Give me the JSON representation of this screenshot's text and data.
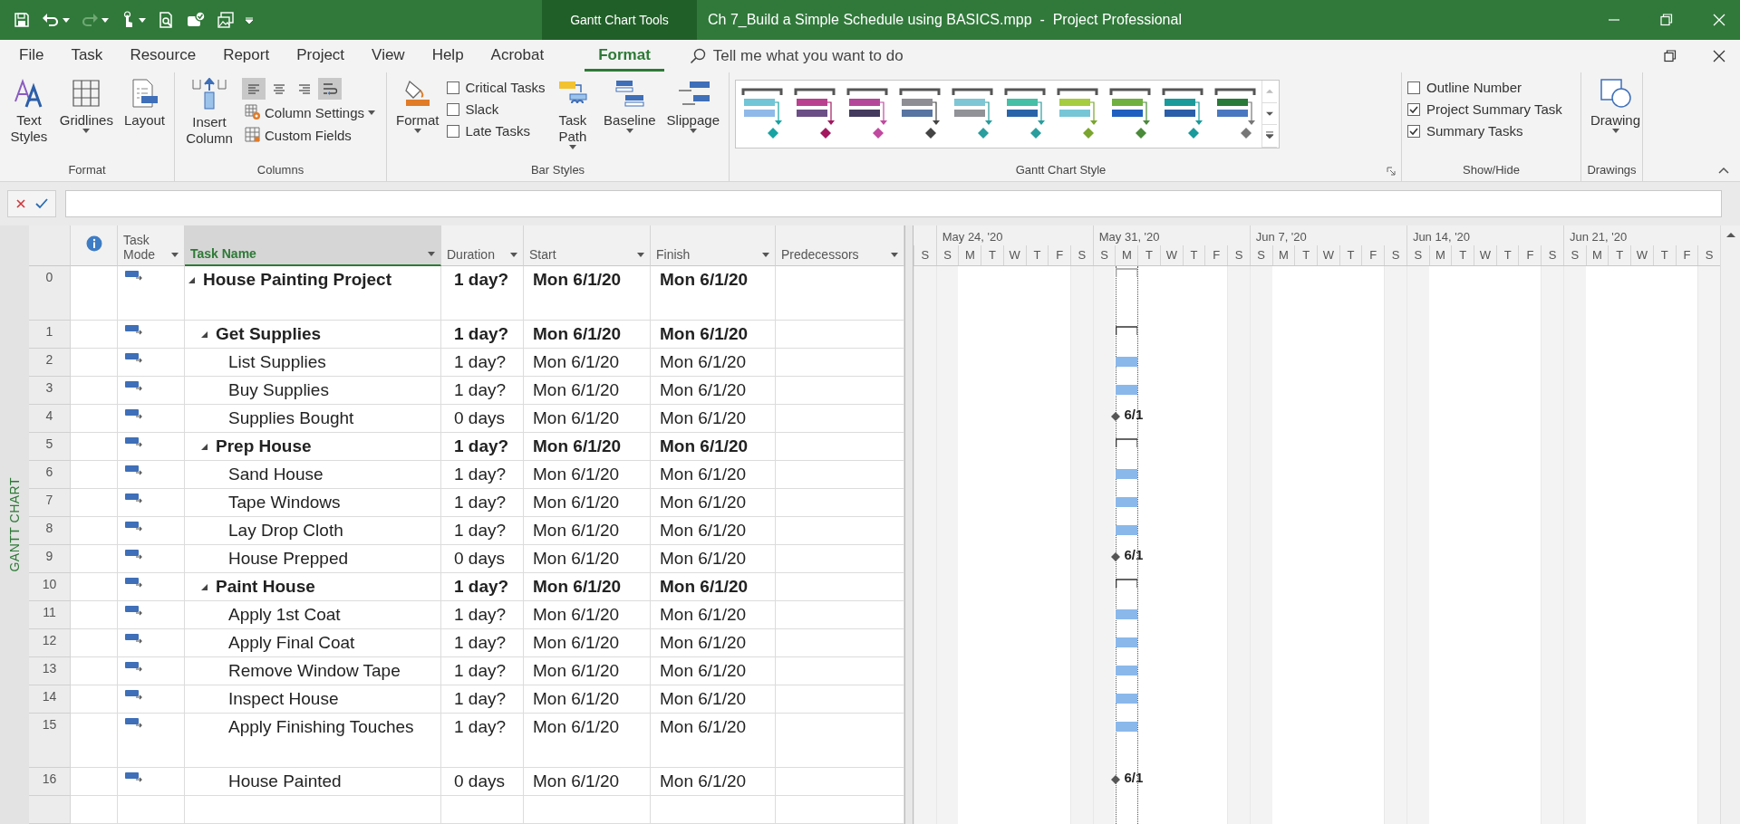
{
  "title_bar": {
    "tool_context": "Gantt Chart Tools",
    "title": "Ch 7_Build a Simple Schedule using BASICS.mpp  -  Project Professional"
  },
  "menu_tabs": [
    {
      "label": "File",
      "selected": false
    },
    {
      "label": "Task",
      "selected": false
    },
    {
      "label": "Resource",
      "selected": false
    },
    {
      "label": "Report",
      "selected": false
    },
    {
      "label": "Project",
      "selected": false
    },
    {
      "label": "View",
      "selected": false
    },
    {
      "label": "Help",
      "selected": false
    },
    {
      "label": "Acrobat",
      "selected": false
    },
    {
      "label": "Format",
      "selected": true
    }
  ],
  "search": {
    "placeholder": "Tell me what you want to do"
  },
  "ribbon": {
    "format_group": {
      "label": "Format",
      "text_styles": "Text Styles",
      "gridlines": "Gridlines",
      "layout": "Layout"
    },
    "columns_group": {
      "label": "Columns",
      "insert_column": "Insert Column",
      "align": [
        {
          "selected": true
        },
        {
          "selected": false
        },
        {
          "selected": false
        }
      ],
      "wrap_text": {
        "selected": true
      },
      "column_settings": "Column Settings",
      "custom_fields": "Custom Fields"
    },
    "bar_styles_group": {
      "label": "Bar Styles",
      "format": "Format",
      "checks": [
        {
          "label": "Critical Tasks",
          "checked": false
        },
        {
          "label": "Slack",
          "checked": false
        },
        {
          "label": "Late Tasks",
          "checked": false
        }
      ],
      "task_path": "Task Path",
      "baseline": "Baseline",
      "slippage": "Slippage"
    },
    "style_group": {
      "label": "Gantt Chart Style",
      "styles": [
        {
          "color": "#71c5d6"
        },
        {
          "color": "#b9408f"
        },
        {
          "color": "#b5479a"
        },
        {
          "color": "#8e8e94"
        },
        {
          "color": "#7ec6d6"
        },
        {
          "color": "#45bfa6"
        },
        {
          "color": "#a6cc40"
        },
        {
          "color": "#70b040"
        },
        {
          "color": "#1a9a9a"
        },
        {
          "color": "#2a7a3a"
        }
      ]
    },
    "show_hide_group": {
      "label": "Show/Hide",
      "checks": [
        {
          "label": "Outline Number",
          "checked": false
        },
        {
          "label": "Project Summary Task",
          "checked": true
        },
        {
          "label": "Summary Tasks",
          "checked": true
        }
      ]
    },
    "drawings_group": {
      "label": "Drawings",
      "drawing": "Drawing"
    }
  },
  "view_label": "GANTT CHART",
  "table": {
    "columns": [
      {
        "label": "Task Mode",
        "selected": false
      },
      {
        "label": "Task Name",
        "selected": true
      },
      {
        "label": "Duration",
        "selected": false
      },
      {
        "label": "Start",
        "selected": false
      },
      {
        "label": "Finish",
        "selected": false
      },
      {
        "label": "Predecessors",
        "selected": false
      }
    ],
    "tasks": [
      {
        "id": "0",
        "name": "House Painting Project",
        "duration": "1 day?",
        "start": "Mon 6/1/20",
        "finish": "Mon 6/1/20",
        "expanded": true,
        "bar": {
          "kind": "project"
        },
        "children": [
          {
            "id": "1",
            "name": "Get Supplies",
            "duration": "1 day?",
            "start": "Mon 6/1/20",
            "finish": "Mon 6/1/20",
            "expanded": true,
            "bar": {
              "kind": "summary"
            },
            "children": [
              {
                "id": "2",
                "name": "List Supplies",
                "duration": "1 day?",
                "start": "Mon 6/1/20",
                "finish": "Mon 6/1/20",
                "bar": {
                  "kind": "task"
                }
              },
              {
                "id": "3",
                "name": "Buy Supplies",
                "duration": "1 day?",
                "start": "Mon 6/1/20",
                "finish": "Mon 6/1/20",
                "bar": {
                  "kind": "task"
                }
              },
              {
                "id": "4",
                "name": "Supplies Bought",
                "duration": "0 days",
                "start": "Mon 6/1/20",
                "finish": "Mon 6/1/20",
                "bar": {
                  "kind": "milestone",
                  "label": "6/1"
                }
              }
            ]
          },
          {
            "id": "5",
            "name": "Prep House",
            "duration": "1 day?",
            "start": "Mon 6/1/20",
            "finish": "Mon 6/1/20",
            "expanded": true,
            "bar": {
              "kind": "summary"
            },
            "children": [
              {
                "id": "6",
                "name": "Sand House",
                "duration": "1 day?",
                "start": "Mon 6/1/20",
                "finish": "Mon 6/1/20",
                "bar": {
                  "kind": "task"
                }
              },
              {
                "id": "7",
                "name": "Tape Windows",
                "duration": "1 day?",
                "start": "Mon 6/1/20",
                "finish": "Mon 6/1/20",
                "bar": {
                  "kind": "task"
                }
              },
              {
                "id": "8",
                "name": "Lay Drop Cloth",
                "duration": "1 day?",
                "start": "Mon 6/1/20",
                "finish": "Mon 6/1/20",
                "bar": {
                  "kind": "task"
                }
              },
              {
                "id": "9",
                "name": "House Prepped",
                "duration": "0 days",
                "start": "Mon 6/1/20",
                "finish": "Mon 6/1/20",
                "bar": {
                  "kind": "milestone",
                  "label": "6/1"
                }
              }
            ]
          },
          {
            "id": "10",
            "name": "Paint House",
            "duration": "1 day?",
            "start": "Mon 6/1/20",
            "finish": "Mon 6/1/20",
            "expanded": true,
            "bar": {
              "kind": "summary"
            },
            "children": [
              {
                "id": "11",
                "name": "Apply 1st Coat",
                "duration": "1 day?",
                "start": "Mon 6/1/20",
                "finish": "Mon 6/1/20",
                "bar": {
                  "kind": "task"
                }
              },
              {
                "id": "12",
                "name": "Apply Final Coat",
                "duration": "1 day?",
                "start": "Mon 6/1/20",
                "finish": "Mon 6/1/20",
                "bar": {
                  "kind": "task"
                }
              },
              {
                "id": "13",
                "name": "Remove Window Tape",
                "duration": "1 day?",
                "start": "Mon 6/1/20",
                "finish": "Mon 6/1/20",
                "bar": {
                  "kind": "task"
                }
              },
              {
                "id": "14",
                "name": "Inspect House",
                "duration": "1 day?",
                "start": "Mon 6/1/20",
                "finish": "Mon 6/1/20",
                "bar": {
                  "kind": "task"
                }
              },
              {
                "id": "15",
                "name": "Apply Finishing Touches",
                "duration": "1 day?",
                "start": "Mon 6/1/20",
                "finish": "Mon 6/1/20",
                "bar": {
                  "kind": "task"
                }
              },
              {
                "id": "16",
                "name": "House Painted",
                "duration": "0 days",
                "start": "Mon 6/1/20",
                "finish": "Mon 6/1/20",
                "bar": {
                  "kind": "milestone",
                  "label": "6/1"
                }
              }
            ]
          }
        ]
      }
    ]
  },
  "timescale": {
    "lead_day": "S",
    "weeks": [
      {
        "label": "May 24, '20",
        "days": [
          "S",
          "M",
          "T",
          "W",
          "T",
          "F",
          "S"
        ]
      },
      {
        "label": "May 31, '20",
        "days": [
          "S",
          "M",
          "T",
          "W",
          "T",
          "F",
          "S"
        ]
      },
      {
        "label": "Jun 7, '20",
        "days": [
          "S",
          "M",
          "T",
          "W",
          "T",
          "F",
          "S"
        ]
      },
      {
        "label": "Jun 14, '20",
        "days": [
          "S",
          "M",
          "T",
          "W",
          "T",
          "F",
          "S"
        ]
      },
      {
        "label": "Jun 21, '20",
        "days": [
          "S",
          "M",
          "T",
          "W",
          "T",
          "F",
          "S"
        ]
      }
    ]
  }
}
